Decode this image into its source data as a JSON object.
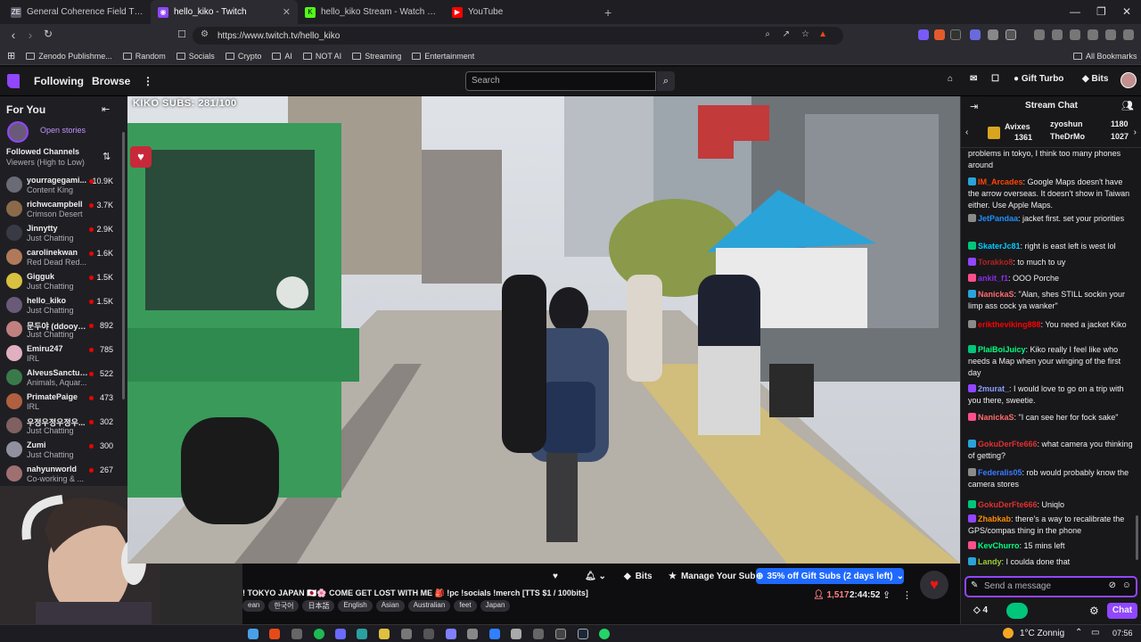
{
  "browser": {
    "tabs": [
      {
        "title": "General Coherence Field Theory (GC",
        "icon_color": "#5a5a66",
        "icon_text": "ZE"
      },
      {
        "title": "hello_kiko - Twitch",
        "icon_color": "#9146ff",
        "icon_text": "◉"
      },
      {
        "title": "hello_kiko Stream - Watch Live o",
        "icon_color": "#53fc18",
        "icon_text": "K"
      },
      {
        "title": "YouTube",
        "icon_color": "#ff0000",
        "icon_text": "▶"
      }
    ],
    "new_tab": "+",
    "url": "https://www.twitch.tv/hello_kiko",
    "bookmarks": [
      "Zenodo Publishme...",
      "Random",
      "Socials",
      "Crypto",
      "AI",
      "NOT AI",
      "Streaming",
      "Entertainment"
    ],
    "all_bookmarks": "All Bookmarks"
  },
  "twitch": {
    "nav": {
      "following": "Following",
      "browse": "Browse",
      "more": "⋮",
      "search_placeholder": "Search",
      "gift_turbo": "Gift Turbo",
      "bits": "Bits"
    },
    "sidebar": {
      "for_you": "For You",
      "open_stories": "Open stories",
      "followed_title": "Followed Channels",
      "followed_sort": "Viewers (High to Low)",
      "channels": [
        {
          "name": "yourragegami...",
          "game": "Content King",
          "viewers": "10.9K",
          "color": "#6b6b76"
        },
        {
          "name": "richwcampbell",
          "game": "Crimson Desert",
          "viewers": "3.7K",
          "color": "#8a6a4a"
        },
        {
          "name": "Jinnytty",
          "game": "Just Chatting",
          "viewers": "2.9K",
          "color": "#3a3a44"
        },
        {
          "name": "carolinekwan",
          "game": "Red Dead Red...",
          "viewers": "1.6K",
          "color": "#b07a5a"
        },
        {
          "name": "Gigguk",
          "game": "Just Chatting",
          "viewers": "1.5K",
          "color": "#d8c040"
        },
        {
          "name": "hello_kiko",
          "game": "Just Chatting",
          "viewers": "1.5K",
          "color": "#6a5a7a"
        },
        {
          "name": "문두야 (ddooyaa)",
          "game": "Just Chatting",
          "viewers": "892",
          "color": "#c08080"
        },
        {
          "name": "Emiru247",
          "game": "IRL",
          "viewers": "785",
          "color": "#e0b0c0"
        },
        {
          "name": "AlveusSanctuary",
          "game": "Animals, Aquar...",
          "viewers": "522",
          "color": "#3a7a4a"
        },
        {
          "name": "PrimatePaige",
          "game": "IRL",
          "viewers": "473",
          "color": "#b06040"
        },
        {
          "name": "우정우정우정우...",
          "game": "Just Chatting",
          "viewers": "302",
          "color": "#806060"
        },
        {
          "name": "Zumi",
          "game": "Just Chatting",
          "viewers": "300",
          "color": "#9090a0"
        },
        {
          "name": "nahyunworld",
          "game": "Co-working & ...",
          "viewers": "267",
          "color": "#a07070"
        }
      ]
    },
    "video": {
      "overlay_subs": "KIKO SUBS: 281/100"
    },
    "stream_info": {
      "title": "! TOKYO JAPAN 🇯🇵🌸 COME GET LOST WITH ME 🎒 !pc !socials !merch [TTS $1 / 100bits]",
      "tags": [
        "ean",
        "한국어",
        "日本語",
        "English",
        "Asian",
        "Australian",
        "feet",
        "Japan"
      ],
      "bits_label": "Bits",
      "manage_sub": "Manage Your Sub",
      "gift_subs": "35% off Gift Subs (2 days left)",
      "viewers": "1,517",
      "uptime": "2:44:52"
    },
    "chat": {
      "header": "Stream Chat",
      "gifters": [
        {
          "name": "Avixes",
          "count": "1361"
        },
        {
          "name": "zyoshun",
          "count": "1180"
        },
        {
          "name": "TheDrMo",
          "count": "1027"
        }
      ],
      "messages": [
        {
          "user": "",
          "color": "#efeff1",
          "text": "problems in tokyo, I think too many phones around"
        },
        {
          "user": "IM_Arcades",
          "color": "#ff4500",
          "text": ": Google Maps doesn't have the arrow overseas. It doesn't show in Taiwan either. Use Apple Maps."
        },
        {
          "user": "JetPandaa",
          "color": "#1e90ff",
          "text": ": jacket first. set your priorities"
        },
        {
          "user": "SkaterJc81",
          "color": "#00ccff",
          "text": ": right is east left is west lol"
        },
        {
          "user": "Torakko8",
          "color": "#b22222",
          "text": ": to much to uy"
        },
        {
          "user": "ankit_f1",
          "color": "#8a2be2",
          "text": ": OOO Porche"
        },
        {
          "user": "NanickaS",
          "color": "#ff6b6b",
          "text": ": \"Alan, shes STILL sockin your limp ass cock ya wanker\""
        },
        {
          "user": "eriktheviking888",
          "color": "#ff0000",
          "text": ": You need a jacket Kiko"
        },
        {
          "user": "PlaiBoiJuicy",
          "color": "#00ff7f",
          "text": ": Kiko really I feel like who needs a Map when your winging of the first day"
        },
        {
          "user": "2murat_",
          "color": "#8aa0ff",
          "text": ": I would love to go on a trip with you there, sweetie."
        },
        {
          "user": "NanickaS",
          "color": "#ff6b6b",
          "text": ": \"I can see her for fock sake\""
        },
        {
          "user": "GokuDerFte666",
          "color": "#e03030",
          "text": ": what camera you thinking of getting?"
        },
        {
          "user": "Federalis05",
          "color": "#3a7bff",
          "text": ": rob would probably know the camera stores"
        },
        {
          "user": "GokuDerFte666",
          "color": "#e03030",
          "text": ": Uniqlo"
        },
        {
          "user": "Zhabkab",
          "color": "#ff8c00",
          "text": ": there's a way to recalibrate the GPS/compas thing in the phone"
        },
        {
          "user": "KevChurro",
          "color": "#00ff7f",
          "text": ": 15 mins left"
        },
        {
          "user": "Landy",
          "color": "#9acd32",
          "text": ": I coulda done that"
        }
      ],
      "input_placeholder": "Send a message",
      "points": "4",
      "chat_button": "Chat"
    }
  },
  "taskbar": {
    "weather": "1°C  Zonnig",
    "time": "07:56"
  }
}
